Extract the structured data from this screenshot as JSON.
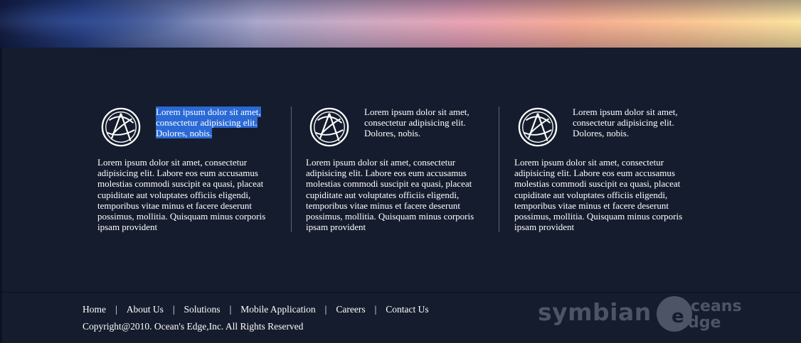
{
  "features": [
    {
      "heading": "Lorem ipsum dolor sit amet, consectetur adipisicing elit. Dolores, nobis.",
      "heading_selected": true,
      "body": "Lorem ipsum dolor sit amet, consectetur adipisicing elit. Labore eos eum accusamus molestias commodi suscipit ea quasi, placeat cupiditate aut voluptates officiis eligendi, temporibus vitae minus et facere deserunt possimus, mollitia. Quisquam minus corporis ipsam provident",
      "icon": "globe-icon"
    },
    {
      "heading": "Lorem ipsum dolor sit amet, consectetur adipisicing elit. Dolores, nobis.",
      "heading_selected": false,
      "body": "Lorem ipsum dolor sit amet, consectetur adipisicing elit. Labore eos eum accusamus molestias commodi suscipit ea quasi, placeat cupiditate aut voluptates officiis eligendi, temporibus vitae minus et facere deserunt possimus, mollitia. Quisquam minus corporis ipsam provident",
      "icon": "globe-icon"
    },
    {
      "heading": "Lorem ipsum dolor sit amet, consectetur adipisicing elit. Dolores, nobis.",
      "heading_selected": false,
      "body": "Lorem ipsum dolor sit amet, consectetur adipisicing elit. Labore eos eum accusamus molestias commodi suscipit ea quasi, placeat cupiditate aut voluptates officiis eligendi, temporibus vitae minus et facere deserunt possimus, mollitia. Quisquam minus corporis ipsam provident",
      "icon": "globe-icon"
    }
  ],
  "footer": {
    "nav": [
      "Home",
      "About Us",
      "Solutions",
      "Mobile Application",
      "Careers",
      "Contact Us"
    ],
    "separator": "|",
    "copyright": "Copyright@2010. Ocean's Edge,Inc. All Rights Reserved",
    "partner_logo": "symbian",
    "company_logo": {
      "line1": "ceans",
      "line2": "dge",
      "name": "Oceans Edge"
    }
  },
  "colors": {
    "background": "#151c2d",
    "selection": "#2a69d6",
    "logo_gray": "#4c5466"
  }
}
